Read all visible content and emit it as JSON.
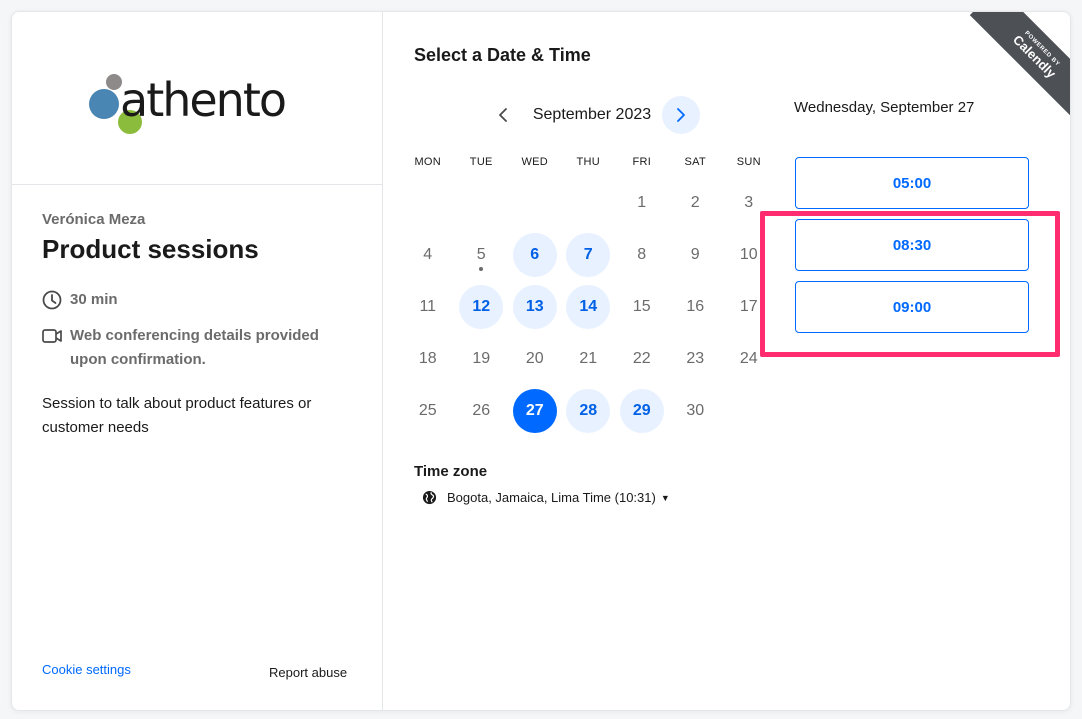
{
  "organizer": {
    "name": "Verónica Meza",
    "logo_text": "athento"
  },
  "event": {
    "title": "Product sessions",
    "duration": "30 min",
    "conferencing": "Web conferencing details provided upon confirmation.",
    "description": "Session to talk about product features or customer needs"
  },
  "footer": {
    "cookie_label": "Cookie settings",
    "report_label": "Report abuse"
  },
  "scheduler": {
    "heading": "Select a Date & Time",
    "month_label": "September 2023",
    "weekdays": [
      "MON",
      "TUE",
      "WED",
      "THU",
      "FRI",
      "SAT",
      "SUN"
    ],
    "days": [
      {
        "n": ""
      },
      {
        "n": ""
      },
      {
        "n": ""
      },
      {
        "n": ""
      },
      {
        "n": "1"
      },
      {
        "n": "2"
      },
      {
        "n": "3"
      },
      {
        "n": "4"
      },
      {
        "n": "5",
        "today": true
      },
      {
        "n": "6",
        "available": true
      },
      {
        "n": "7",
        "available": true
      },
      {
        "n": "8"
      },
      {
        "n": "9"
      },
      {
        "n": "10"
      },
      {
        "n": "11"
      },
      {
        "n": "12",
        "available": true
      },
      {
        "n": "13",
        "available": true
      },
      {
        "n": "14",
        "available": true
      },
      {
        "n": "15"
      },
      {
        "n": "16"
      },
      {
        "n": "17"
      },
      {
        "n": "18"
      },
      {
        "n": "19"
      },
      {
        "n": "20"
      },
      {
        "n": "21"
      },
      {
        "n": "22"
      },
      {
        "n": "23"
      },
      {
        "n": "24"
      },
      {
        "n": "25"
      },
      {
        "n": "26"
      },
      {
        "n": "27",
        "selected": true
      },
      {
        "n": "28",
        "available": true
      },
      {
        "n": "29",
        "available": true
      },
      {
        "n": "30"
      }
    ],
    "timezone_label": "Time zone",
    "timezone_value": "Bogota, Jamaica, Lima Time (10:31)",
    "selected_date": "Wednesday, September 27",
    "time_slots": [
      "05:00",
      "08:30",
      "09:00"
    ]
  },
  "badge": {
    "powered_by": "POWERED BY",
    "brand": "Calendly"
  },
  "colors": {
    "primary": "#0069ff",
    "available_bg": "#e8f1ff",
    "highlight": "#ff2d6f",
    "muted_text": "#6b6b6b"
  }
}
